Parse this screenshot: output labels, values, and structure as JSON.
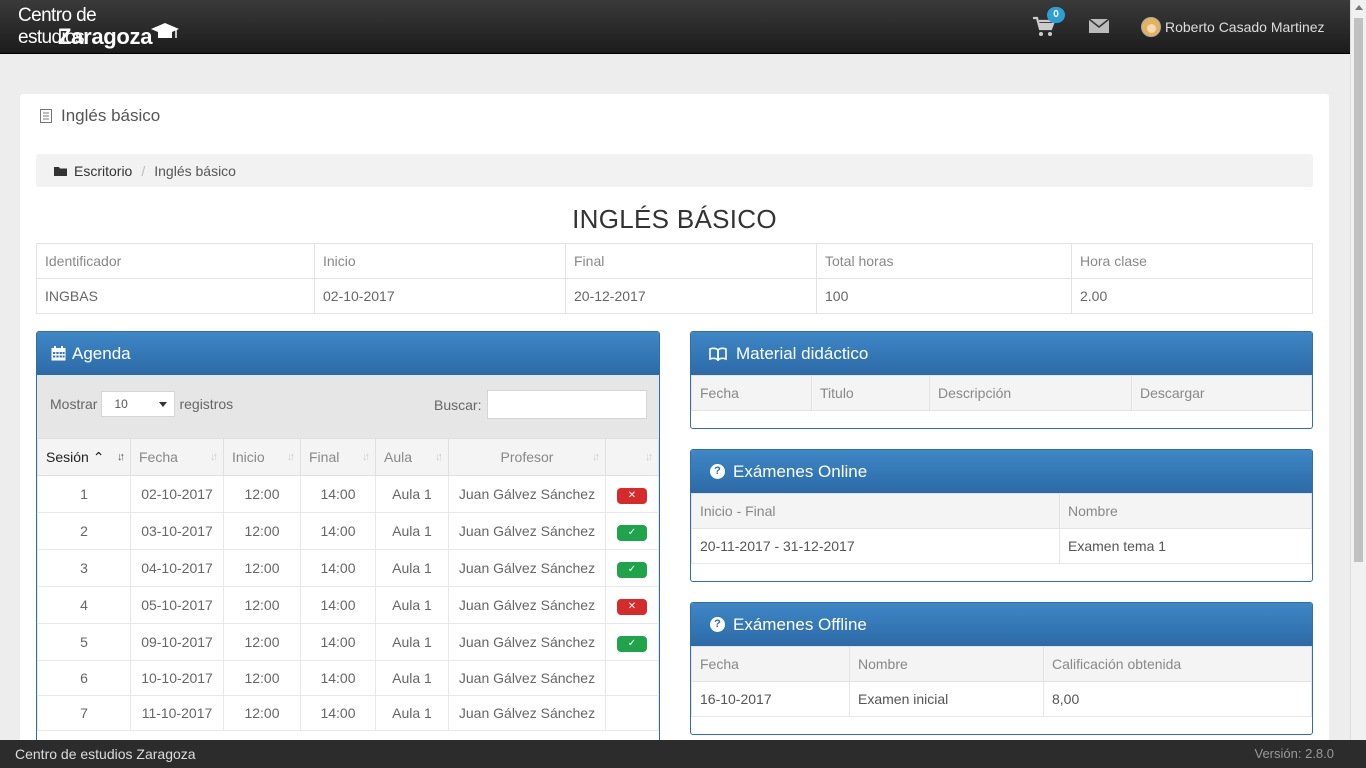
{
  "navbar": {
    "logo_line1": "Centro de estudios",
    "logo_line2": "Zaragoza",
    "cart_count": "0",
    "user_name": "Roberto Casado Martinez"
  },
  "page": {
    "panel_title": "Inglés básico",
    "breadcrumb": [
      "Escritorio",
      "Inglés básico"
    ],
    "course_title": "INGLÉS BÁSICO"
  },
  "course_info": {
    "headers": [
      "Identificador",
      "Inicio",
      "Final",
      "Total horas",
      "Hora clase"
    ],
    "values": [
      "INGBAS",
      "02-10-2017",
      "20-12-2017",
      "100",
      "2.00"
    ]
  },
  "agenda": {
    "title": "Agenda",
    "show_label": "Mostrar",
    "page_size": "10",
    "records_label": "registros",
    "search_label": "Buscar:",
    "columns": [
      "Sesión",
      "Fecha",
      "Inicio",
      "Final",
      "Aula",
      "Profesor"
    ],
    "rows": [
      {
        "sesion": "1",
        "fecha": "02-10-2017",
        "inicio": "12:00",
        "final": "14:00",
        "aula": "Aula 1",
        "profesor": "Juan Gálvez Sánchez",
        "status": "absent"
      },
      {
        "sesion": "2",
        "fecha": "03-10-2017",
        "inicio": "12:00",
        "final": "14:00",
        "aula": "Aula 1",
        "profesor": "Juan Gálvez Sánchez",
        "status": "present"
      },
      {
        "sesion": "3",
        "fecha": "04-10-2017",
        "inicio": "12:00",
        "final": "14:00",
        "aula": "Aula 1",
        "profesor": "Juan Gálvez Sánchez",
        "status": "present"
      },
      {
        "sesion": "4",
        "fecha": "05-10-2017",
        "inicio": "12:00",
        "final": "14:00",
        "aula": "Aula 1",
        "profesor": "Juan Gálvez Sánchez",
        "status": "absent"
      },
      {
        "sesion": "5",
        "fecha": "09-10-2017",
        "inicio": "12:00",
        "final": "14:00",
        "aula": "Aula 1",
        "profesor": "Juan Gálvez Sánchez",
        "status": "present"
      },
      {
        "sesion": "6",
        "fecha": "10-10-2017",
        "inicio": "12:00",
        "final": "14:00",
        "aula": "Aula 1",
        "profesor": "Juan Gálvez Sánchez",
        "status": ""
      },
      {
        "sesion": "7",
        "fecha": "11-10-2017",
        "inicio": "12:00",
        "final": "14:00",
        "aula": "Aula 1",
        "profesor": "Juan Gálvez Sánchez",
        "status": ""
      }
    ],
    "status_colors": {
      "absent": "#d72b2b",
      "present": "#1fa44c"
    }
  },
  "material": {
    "title": "Material didáctico",
    "columns": [
      "Fecha",
      "Titulo",
      "Descripción",
      "Descargar"
    ]
  },
  "exams_online": {
    "title": "Exámenes Online",
    "columns": [
      "Inicio - Final",
      "Nombre"
    ],
    "rows": [
      [
        "20-11-2017 - 31-12-2017",
        "Examen tema 1"
      ]
    ]
  },
  "exams_offline": {
    "title": "Exámenes Offline",
    "columns": [
      "Fecha",
      "Nombre",
      "Calificación obtenida"
    ],
    "rows": [
      [
        "16-10-2017",
        "Examen inicial",
        "8,00"
      ]
    ]
  },
  "footer": {
    "brand": "Centro de estudios Zaragoza",
    "version": "Versión: 2.8.0"
  },
  "colors": {
    "navbar": "#2a2a2a",
    "box_header": "#3376b5",
    "badge": "#2c9fd6"
  }
}
